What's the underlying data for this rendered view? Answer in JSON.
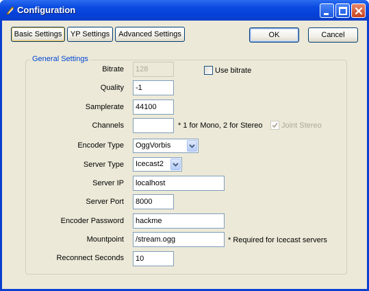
{
  "window": {
    "title": "Configuration",
    "title_icon": "configuration-app-icon",
    "controls": [
      "minimize-icon",
      "maximize-icon",
      "close-icon"
    ]
  },
  "tabs": [
    {
      "label": "Basic Settings",
      "selected": true
    },
    {
      "label": "YP Settings",
      "selected": false
    },
    {
      "label": "Advanced Settings",
      "selected": false
    }
  ],
  "buttons": {
    "ok": "OK",
    "cancel": "Cancel"
  },
  "group": {
    "title": "General Settings"
  },
  "fields": {
    "bitrate": {
      "label": "Bitrate",
      "value": "128",
      "disabled": true
    },
    "use_bitrate": {
      "label": "Use bitrate",
      "checked": false
    },
    "quality": {
      "label": "Quality",
      "value": "-1"
    },
    "samplerate": {
      "label": "Samplerate",
      "value": "44100"
    },
    "channels": {
      "label": "Channels",
      "value": "",
      "note": "* 1 for Mono, 2 for Stereo"
    },
    "joint_stereo": {
      "label": "Joint Stereo",
      "checked": true,
      "disabled": true
    },
    "encoder_type": {
      "label": "Encoder Type",
      "value": "OggVorbis"
    },
    "server_type": {
      "label": "Server Type",
      "value": "Icecast2"
    },
    "server_ip": {
      "label": "Server IP",
      "value": "localhost"
    },
    "server_port": {
      "label": "Server Port",
      "value": "8000"
    },
    "encoder_password": {
      "label": "Encoder Password",
      "value": "hackme"
    },
    "mountpoint": {
      "label": "Mountpoint",
      "value": "/stream.ogg",
      "note": "* Required for Icecast servers"
    },
    "reconnect_seconds": {
      "label": "Reconnect Seconds",
      "value": "10"
    }
  },
  "colors": {
    "title_bar": "#0540d8",
    "accent_group_title": "#0046d5",
    "dialog_bg": "#ece9d8"
  }
}
